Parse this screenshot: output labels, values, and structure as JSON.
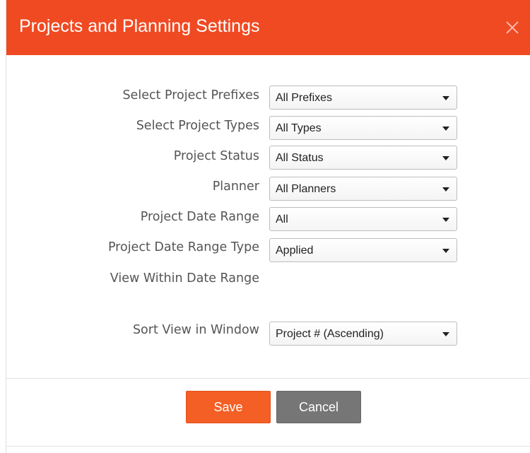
{
  "dialog": {
    "title": "Projects and Planning Settings",
    "close_icon": "close-icon",
    "header_color": "#f04a23"
  },
  "fields": [
    {
      "label": "Select Project Prefixes",
      "value": "All Prefixes"
    },
    {
      "label": "Select Project Types",
      "value": "All Types"
    },
    {
      "label": "Project Status",
      "value": "All Status"
    },
    {
      "label": "Planner",
      "value": "All Planners"
    },
    {
      "label": "Project Date Range",
      "value": "All"
    },
    {
      "label": "Project Date Range Type",
      "value": "Applied"
    }
  ],
  "view_within": {
    "label": "View Within Date Range"
  },
  "sort": {
    "label": "Sort View in Window",
    "value": "Project # (Ascending)"
  },
  "buttons": {
    "save_label": "Save",
    "cancel_label": "Cancel",
    "save_color": "#f45f25",
    "cancel_color": "#767676"
  }
}
